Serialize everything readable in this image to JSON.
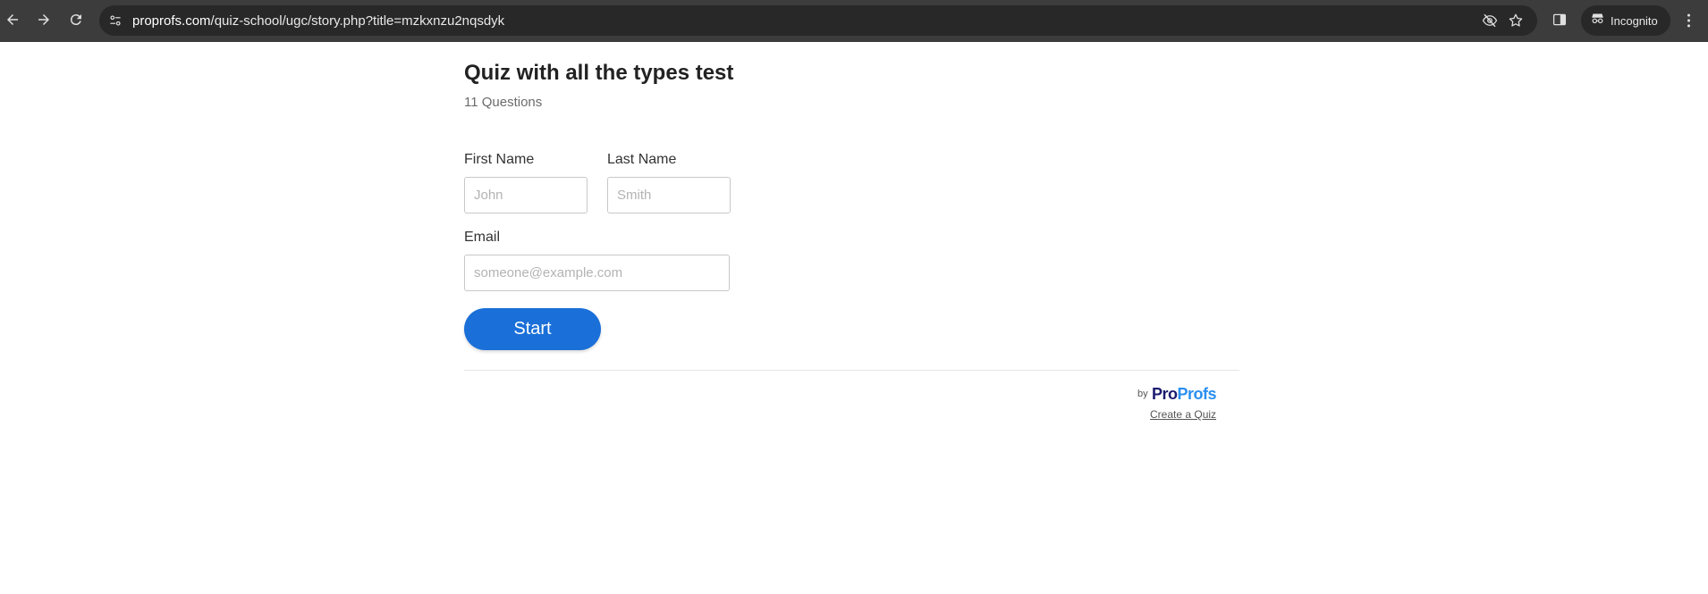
{
  "browser": {
    "url_host": "proprofs.com",
    "url_path": "/quiz-school/ugc/story.php?title=mzkxnzu2nqsdyk",
    "incognito_label": "Incognito"
  },
  "quiz": {
    "title": "Quiz with all the types test",
    "question_count": "11 Questions"
  },
  "form": {
    "first_name_label": "First Name",
    "first_name_placeholder": "John",
    "last_name_label": "Last Name",
    "last_name_placeholder": "Smith",
    "email_label": "Email",
    "email_placeholder": "someone@example.com",
    "start_label": "Start"
  },
  "footer": {
    "by_text": "by",
    "logo_pro": "Pro",
    "logo_profs": "Profs",
    "create_link": "Create a Quiz"
  },
  "colors": {
    "toolbar_bg": "#3c3c3c",
    "omnibox_bg": "#282828",
    "start_button": "#1a6fd8",
    "logo_dark": "#1a1a6e",
    "logo_light": "#2a8ff0"
  }
}
